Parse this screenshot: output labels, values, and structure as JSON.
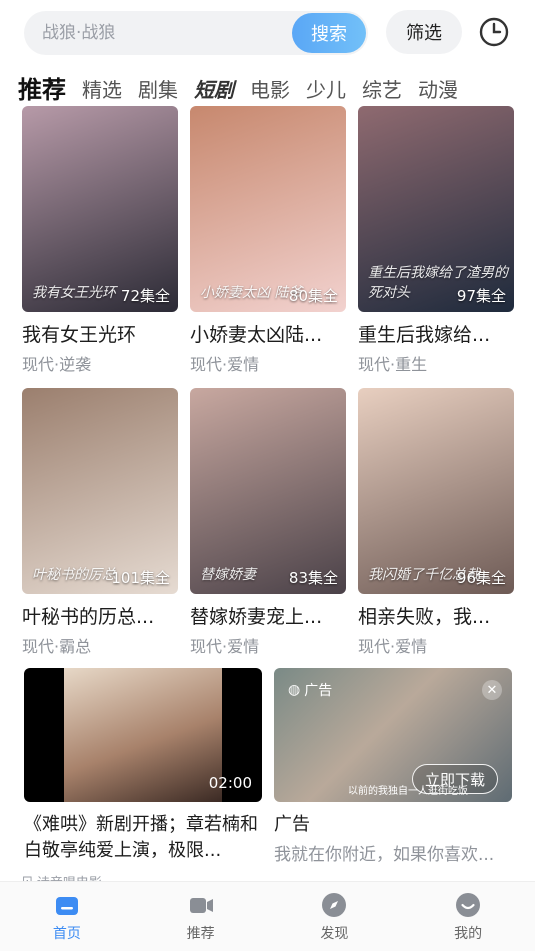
{
  "search": {
    "placeholder": "战狼·战狼",
    "button_label": "搜索",
    "filter_label": "筛选"
  },
  "tabs": [
    {
      "label": "推荐"
    },
    {
      "label": "精选"
    },
    {
      "label": "剧集"
    },
    {
      "label": "短剧"
    },
    {
      "label": "电影"
    },
    {
      "label": "少儿"
    },
    {
      "label": "综艺"
    },
    {
      "label": "动漫"
    }
  ],
  "cards": [
    {
      "title": "我有女王光环",
      "tags": "现代·逆袭",
      "episodes": "72集全",
      "poster_text": "我有女王光环",
      "color1": "#2b2a35",
      "color2": "#b79aa8"
    },
    {
      "title": "小娇妻太凶陆...",
      "tags": "现代·爱情",
      "episodes": "80集全",
      "poster_text": "小娇妻太凶 陆爷",
      "color1": "#f2d2cf",
      "color2": "#c7886e"
    },
    {
      "title": "重生后我嫁给...",
      "tags": "现代·重生",
      "episodes": "97集全",
      "poster_text": "重生后我嫁给了渣男的死对头",
      "color1": "#1e2a3c",
      "color2": "#8f6a70"
    },
    {
      "title": "叶秘书的历总...",
      "tags": "现代·霸总",
      "episodes": "101集全",
      "poster_text": "叶秘书的厉总",
      "color1": "#e6dbd2",
      "color2": "#9b7f6e"
    },
    {
      "title": "替嫁娇妻宠上...",
      "tags": "现代·爱情",
      "episodes": "83集全",
      "poster_text": "替嫁娇妻",
      "color1": "#4a4148",
      "color2": "#c8a8a0"
    },
    {
      "title": "相亲失败，我...",
      "tags": "现代·爱情",
      "episodes": "96集全",
      "poster_text": "我闪婚了千亿总裁",
      "color1": "#6d5a55",
      "color2": "#e8cfc0"
    }
  ],
  "feature": {
    "title": "《难哄》新剧开播；章若楠和白敬亭纯爱上演，极限...",
    "duration": "02:00",
    "source": "诗音唱电影"
  },
  "ad": {
    "badge": "广告",
    "title": "广告",
    "subtitle": "我就在你附近，如果你喜欢...",
    "download_label": "立即下载",
    "caption": "以前的我独自一人逛街吃饭"
  },
  "nav": [
    {
      "label": "首页",
      "icon": "home-icon",
      "active": true
    },
    {
      "label": "推荐",
      "icon": "video-icon",
      "active": false
    },
    {
      "label": "发现",
      "icon": "compass-icon",
      "active": false
    },
    {
      "label": "我的",
      "icon": "smile-icon",
      "active": false
    }
  ],
  "colors": {
    "accent": "#3d8cf3",
    "search_button": "#5aa7f6"
  }
}
